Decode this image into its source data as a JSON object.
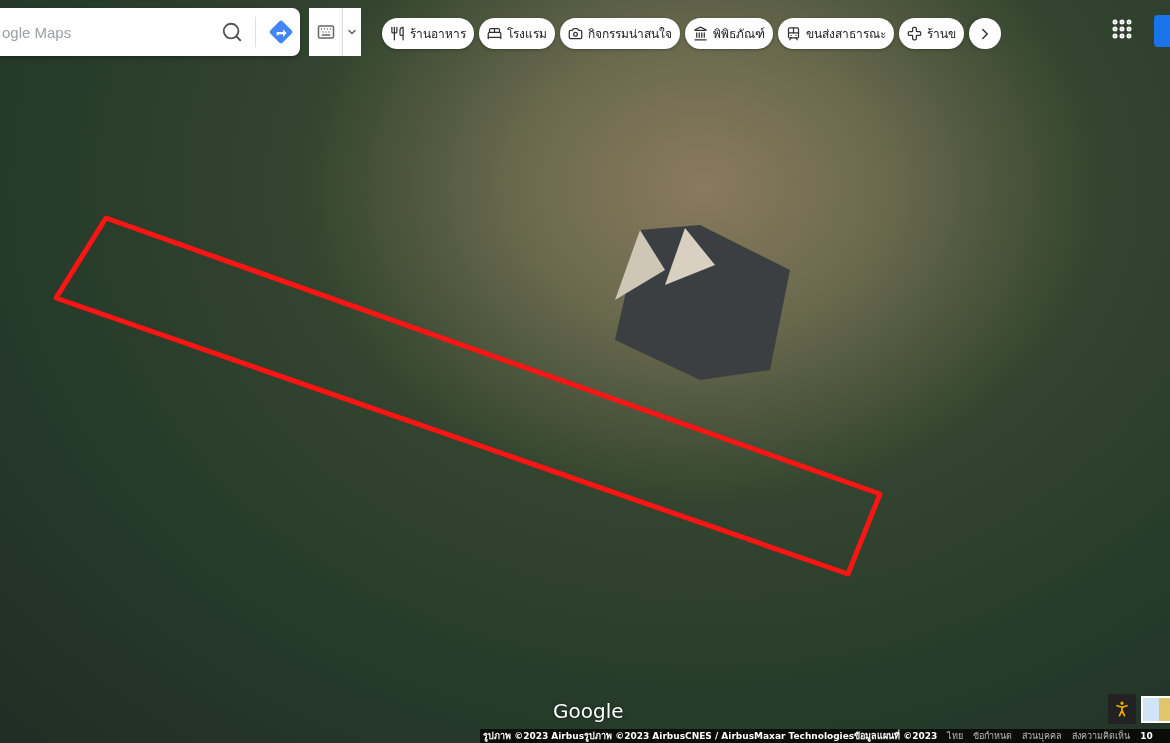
{
  "search": {
    "placeholder": "ogle Maps"
  },
  "chips": [
    {
      "label": "ร้านอาหาร"
    },
    {
      "label": "โรงแรม"
    },
    {
      "label": "กิจกรรมน่าสนใจ"
    },
    {
      "label": "พิพิธภัณฑ์"
    },
    {
      "label": "ขนส่งสาธารณะ"
    },
    {
      "label": "ร้านข"
    }
  ],
  "logo": "Google",
  "footer": {
    "attribution": [
      "รูปภาพ ©2023 Airbus",
      "รูปภาพ ©2023 AirbusCNES / AirbusMaxar Technologies",
      "ข้อมูลแผนที่ ©2023"
    ],
    "links": [
      "ไทย",
      "ข้อกำหนด",
      "ส่วนบุคคล",
      "ส่งความคิดเห็น"
    ],
    "scale": "10"
  }
}
